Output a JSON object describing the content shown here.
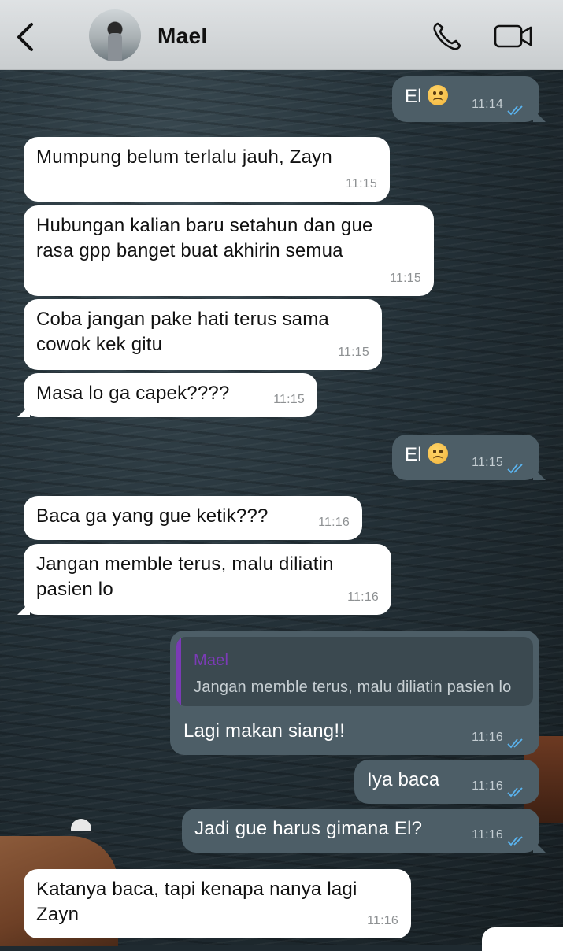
{
  "header": {
    "contact_name": "Mael",
    "back_icon": "chevron-left-icon",
    "call_icon": "phone-icon",
    "video_icon": "video-camera-icon"
  },
  "colors": {
    "incoming_bubble": "#ffffff",
    "outgoing_bubble": "#4d5e67",
    "read_ticks": "#5ab4f0",
    "reply_accent": "#7b3bb6"
  },
  "messages": [
    {
      "dir": "out",
      "text": "El",
      "emoji": "frowning-face",
      "time": "11:14",
      "read": true
    },
    {
      "dir": "in",
      "lines": [
        "Mumpung belum terlalu jauh, Zayn"
      ],
      "time": "11:15"
    },
    {
      "dir": "in",
      "lines": [
        "Hubungan kalian baru setahun dan gue",
        "rasa gpp banget buat akhirin semua"
      ],
      "time": "11:15"
    },
    {
      "dir": "in",
      "lines": [
        "Coba jangan pake hati terus sama",
        "cowok kek gitu"
      ],
      "time": "11:15"
    },
    {
      "dir": "in",
      "lines": [
        "Masa lo ga capek????"
      ],
      "time": "11:15"
    },
    {
      "dir": "out",
      "text": "El",
      "emoji": "frowning-face",
      "time": "11:15",
      "read": true
    },
    {
      "dir": "in",
      "lines": [
        "Baca ga yang gue ketik???"
      ],
      "time": "11:16"
    },
    {
      "dir": "in",
      "lines": [
        "Jangan memble terus, malu diliatin",
        "pasien lo"
      ],
      "time": "11:16"
    },
    {
      "dir": "out",
      "reply": {
        "name": "Mael",
        "text": "Jangan memble terus, malu diliatin pasien lo"
      },
      "text": "Lagi makan siang!!",
      "time": "11:16",
      "read": true
    },
    {
      "dir": "out",
      "text": "Iya baca",
      "time": "11:16",
      "read": true
    },
    {
      "dir": "out",
      "text": "Jadi gue harus gimana El?",
      "time": "11:16",
      "read": true
    },
    {
      "dir": "in",
      "lines": [
        "Katanya baca, tapi kenapa nanya lagi",
        "Zayn"
      ],
      "time": "11:16"
    }
  ]
}
